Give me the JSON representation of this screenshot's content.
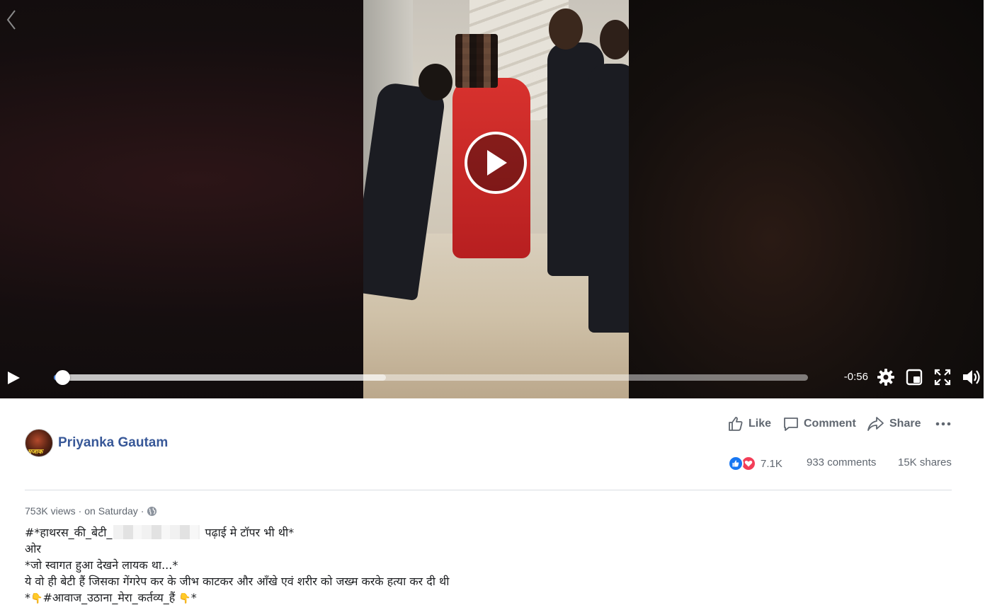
{
  "video": {
    "time_remaining": "-0:56",
    "progress_fraction": 0.01,
    "buffered_fraction": 0.44
  },
  "post": {
    "author": "Priyanka Gautam",
    "avatar_text": "मजाक",
    "actions": {
      "like": "Like",
      "comment": "Comment",
      "share": "Share"
    },
    "reactions_count": "7.1K",
    "comments": "933 comments",
    "shares": "15K shares",
    "views": "753K views",
    "dot": "·",
    "posted": "on Saturday",
    "caption": {
      "line1_a": "#*हाथरस_की_बेटी_",
      "line1_b": " पढ़ाई मे टॉपर भी थी*",
      "line2": "ओर",
      "line3": "*जो स्वागत हुआ देखने लायक था...*",
      "line4": "ये वो ही बेटी हैं जिसका गेंगरेप कर के जीभ काटकर और आँखे एवं शरीर को जख्म करके हत्या कर दी थी",
      "line5_a": "*",
      "line5_b": "#आवाज_उठाना_मेरा_कर्तव्य_हैं ",
      "line5_c": "*"
    }
  },
  "colors": {
    "link": "#385898",
    "progress": "#4a8cf4",
    "like_blue": "#1877f2",
    "love_red": "#f33e58"
  },
  "icons": [
    "back-chevron-icon",
    "play-icon",
    "settings-gear-icon",
    "pip-icon",
    "fullscreen-icon",
    "volume-icon",
    "like-thumb-icon",
    "comment-bubble-icon",
    "share-arrow-icon",
    "more-dots-icon",
    "globe-icon",
    "pointing-hand-icon"
  ]
}
